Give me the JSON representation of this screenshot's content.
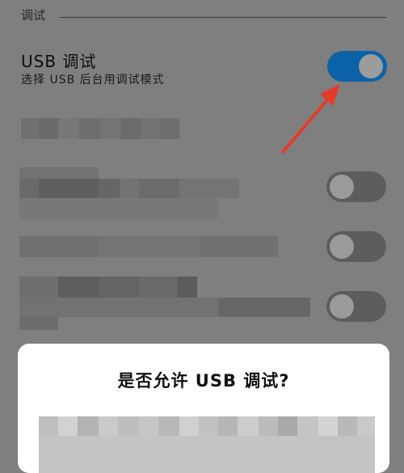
{
  "section": {
    "title": "调试"
  },
  "usb_debugging": {
    "title": "USB 调试",
    "subtitle": "选择 USB 后台用调试模式",
    "enabled": true
  },
  "settings_rows": [
    {
      "label": "",
      "enabled": false
    },
    {
      "label": "",
      "enabled": false
    },
    {
      "label": "",
      "enabled": false
    }
  ],
  "dialog": {
    "title": "是否允许 USB 调试?"
  },
  "colors": {
    "toggle_on": "#0b62a6",
    "arrow": "#e23c2d",
    "background": "#7f7f7f"
  },
  "icons": [
    "red-pointer-arrow"
  ]
}
